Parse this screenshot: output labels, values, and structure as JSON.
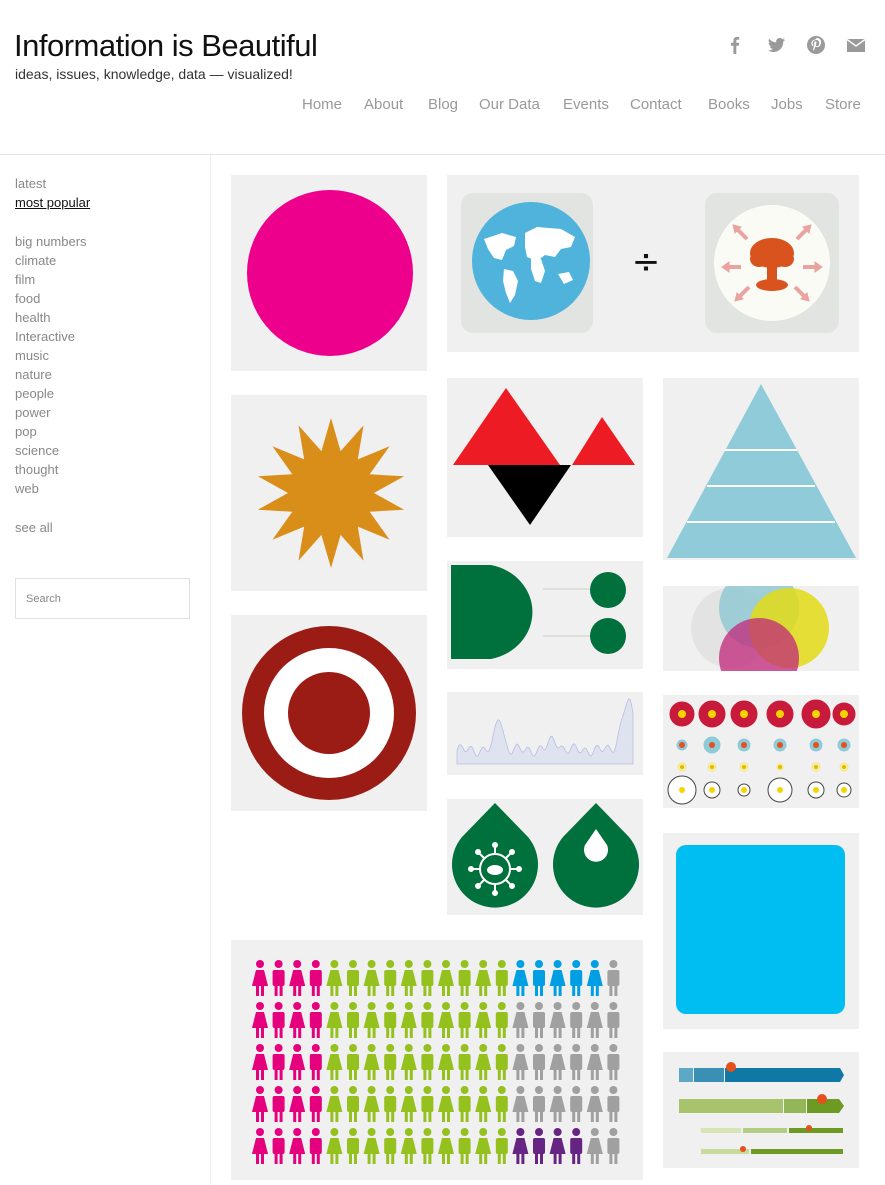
{
  "site": {
    "title": "Information is Beautiful",
    "tagline": "ideas, issues, knowledge, data — visualized!"
  },
  "social_icons": [
    "facebook-icon",
    "twitter-icon",
    "pinterest-icon",
    "mail-icon"
  ],
  "nav": [
    "Home",
    "About",
    "Blog",
    "Our Data",
    "Events",
    "Contact",
    "Books",
    "Jobs",
    "Store"
  ],
  "sidebar": {
    "views": [
      {
        "label": "latest",
        "active": false
      },
      {
        "label": "most popular",
        "active": true
      }
    ],
    "categories": [
      "big numbers",
      "climate",
      "film",
      "food",
      "health",
      "Interactive",
      "music",
      "nature",
      "people",
      "power",
      "pop",
      "science",
      "thought",
      "web"
    ],
    "see_all": "see all",
    "search_placeholder": "Search"
  },
  "divide_symbol": "÷",
  "colors": {
    "magenta": "#ec008c",
    "globe_blue": "#4fb3dc",
    "mushroom": "#d9531e",
    "sun": "#d98e1a",
    "red": "#ed1c24",
    "black": "#000000",
    "pyramid": "#8fcbd8",
    "green": "#00703c",
    "target_red": "#9b1b15",
    "cyan_square": "#00bdf2",
    "people_pink": "#e5007e",
    "people_lime": "#95c11f",
    "people_blue": "#009fe3",
    "people_grey": "#a0a0a0",
    "people_purple": "#662483"
  },
  "thumbnails": [
    "magenta-circle-thumbnail",
    "earth-divided-by-bomb-thumbnail",
    "sun-thumbnail",
    "red-black-triangles-thumbnail",
    "pyramid-thumbnail",
    "green-shapes-thumbnail",
    "venn-circles-thumbnail",
    "target-thumbnail",
    "area-chart-thumbnail",
    "dot-grid-thumbnail",
    "drops-thumbnail",
    "blue-square-thumbnail",
    "people-pictogram-thumbnail",
    "bar-timeline-thumbnail"
  ],
  "pictogram_rows": [
    "PPPPLLLLLLLLLLBBBBBG",
    "PPPPLLLLLLLLLLGGGGGG",
    "PPPPLLLLLLLLLLGGGGGG",
    "PPPPLLLLLLLLLLGGGGGG",
    "PPPPLLLLLLLLLLUUUUGG"
  ]
}
